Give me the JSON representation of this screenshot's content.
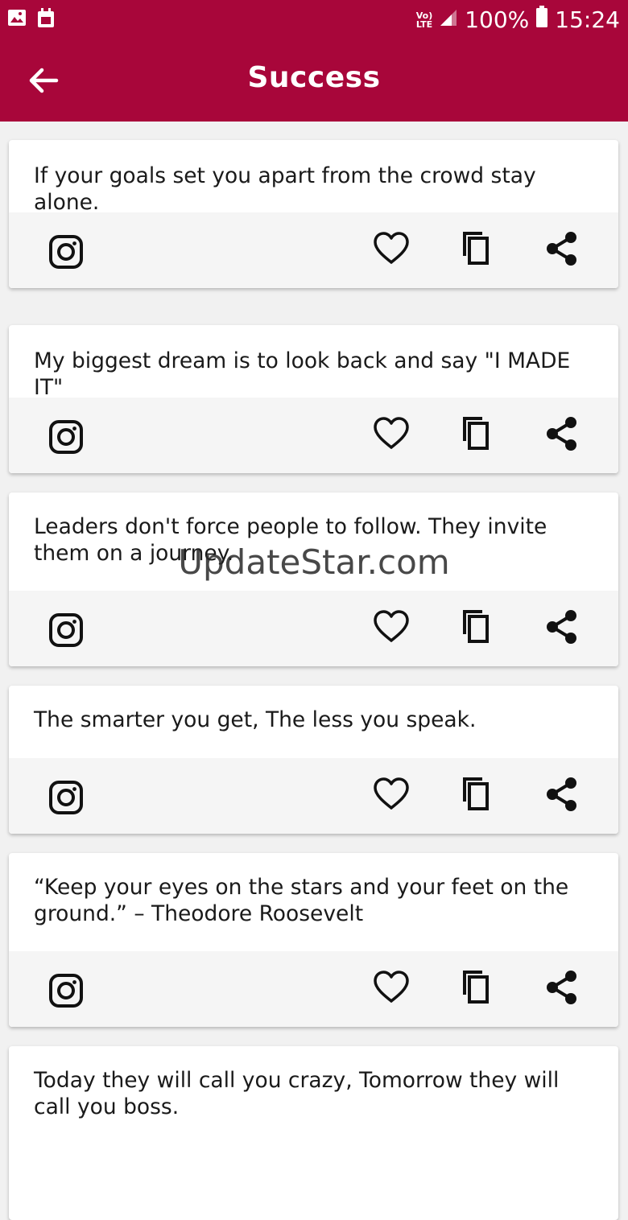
{
  "status_bar": {
    "network": "LTE",
    "battery": "100%",
    "time": "15:24"
  },
  "app_bar": {
    "title": "Success"
  },
  "quotes": [
    {
      "text": "If your goals set you apart from the crowd stay alone."
    },
    {
      "text": "My biggest dream is to look back and say \"I MADE IT\""
    },
    {
      "text": "Leaders don't force people to follow. They invite them on a journey."
    },
    {
      "text": "The smarter you get, The less you speak."
    },
    {
      "text": "“Keep your eyes on the stars and your feet on the ground.” – Theodore Roosevelt"
    },
    {
      "text": "Today they will call you crazy, Tomorrow they will call you boss."
    }
  ],
  "actions": {
    "icons": [
      "instagram-icon",
      "heart-icon",
      "copy-icon",
      "share-icon"
    ]
  },
  "watermark": "UpdateStar.com",
  "colors": {
    "primary": "#a8063a",
    "background": "#f1f1f1",
    "card": "#ffffff",
    "action_bar": "#f5f5f5"
  }
}
